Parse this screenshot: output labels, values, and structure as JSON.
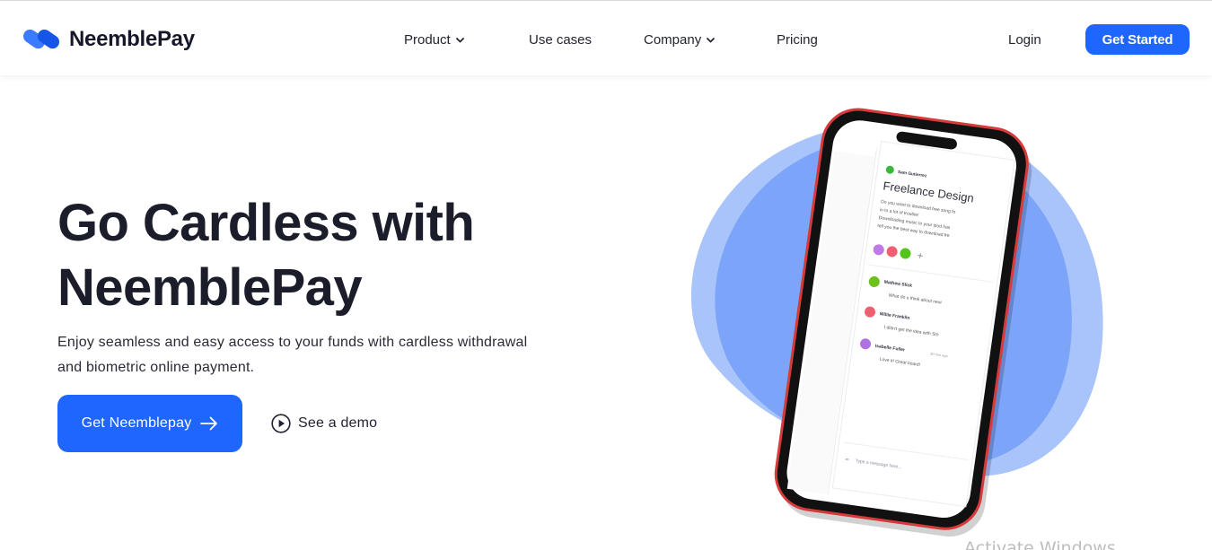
{
  "brand": {
    "name": "NeemblePay",
    "accent": "#1f66ff"
  },
  "nav": {
    "items": [
      {
        "label": "Product",
        "has_dropdown": true
      },
      {
        "label": "Use cases",
        "has_dropdown": false
      },
      {
        "label": "Company",
        "has_dropdown": true
      },
      {
        "label": "Pricing",
        "has_dropdown": false
      }
    ],
    "login_label": "Login",
    "cta_label": "Get Started"
  },
  "hero": {
    "title_line1": "Go Cardless with",
    "title_line2": "NeemblePay",
    "subtitle_line1": "Enjoy seamless and easy access to your funds with cardless withdrawal",
    "subtitle_line2": "and biometric online payment.",
    "primary_cta": "Get Neemblepay",
    "secondary_cta": "See a demo"
  },
  "phone_screen": {
    "post_author": "Sam Gutierrez",
    "post_title": "Freelance Design",
    "post_body_lines": [
      "Do you want to download free song fo",
      "in to a lot of trouble!",
      "Downloading music to your ipod has",
      "tell you the best way to download fre"
    ],
    "comments": [
      {
        "name": "Mathew Slick",
        "text": "What do u think about next",
        "time": ""
      },
      {
        "name": "Willie Franklin",
        "text": "I didn't get the idea with Sto",
        "time": ""
      },
      {
        "name": "Isabelle Fuller",
        "text": "Love it! Great board!",
        "time": "30 min ago"
      }
    ],
    "input_placeholder": "Type a message here..."
  },
  "overlay": {
    "watermark": "Activate Windows"
  }
}
